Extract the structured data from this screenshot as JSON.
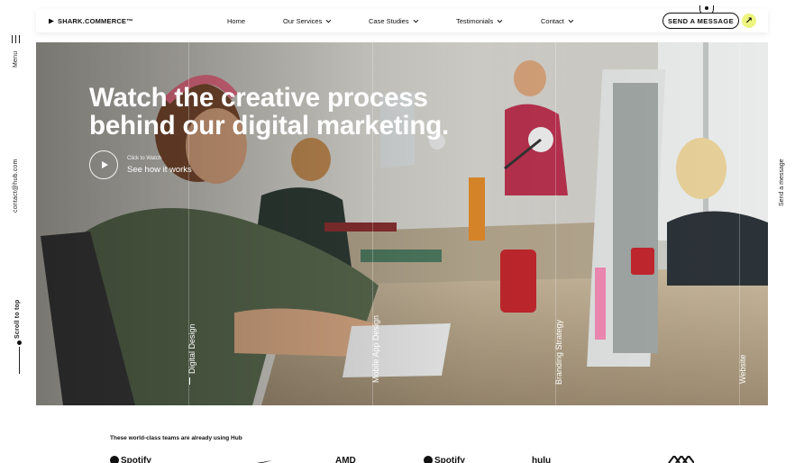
{
  "rail": {
    "menu_label": "Menu",
    "email": "contact@hub.com",
    "scroll_label": "Scroll to top",
    "send_label": "Send a message"
  },
  "nav": {
    "brand": "SHARK.COMMERCE™",
    "items": [
      {
        "label": "Home",
        "has_dropdown": false
      },
      {
        "label": "Our Services",
        "has_dropdown": true
      },
      {
        "label": "Case Studies",
        "has_dropdown": true
      },
      {
        "label": "Testimonials",
        "has_dropdown": true
      },
      {
        "label": "Contact",
        "has_dropdown": true
      }
    ],
    "cta_label": "SEND A MESSAGE",
    "cta_arrow": "↗",
    "accent_color": "#eef57e"
  },
  "hero": {
    "title_line1": "Watch the creative process",
    "title_line2": "behind our digital marketing.",
    "play_small": "Click to Watch",
    "play_big": "See how it works",
    "categories": [
      "Digital Design",
      "Mobile App Design",
      "Branding Strategy",
      "Website"
    ]
  },
  "clients": {
    "heading": "These world-class teams are already using Hub",
    "logos": [
      "Spotify",
      "Nike",
      "AMD",
      "Spotify",
      "hulu",
      "logo"
    ]
  }
}
